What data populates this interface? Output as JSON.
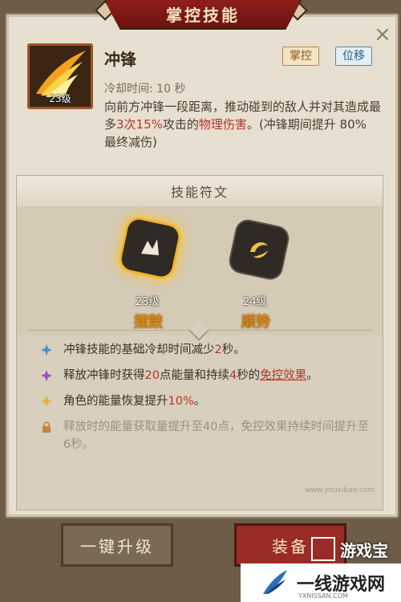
{
  "window": {
    "title": "掌控技能"
  },
  "skill": {
    "name": "冲锋",
    "level": "23级",
    "tags": [
      "掌控",
      "位移"
    ],
    "cooldown": "冷却时间: 10 秒",
    "desc_parts": [
      "向前方冲锋一段距离，推动碰到的敌人并对其造成最多",
      "3次15%",
      "攻击的",
      "物理伤害",
      "。(冲锋期间提升 80% 最终减伤)"
    ]
  },
  "runes": {
    "header": "技能符文",
    "items": [
      {
        "level": "23级",
        "name": "擂鼓"
      },
      {
        "level": "24级",
        "name": "顺势"
      }
    ]
  },
  "effects": [
    {
      "icon": "blue-diamond-icon",
      "parts": [
        "冲锋技能的基础冷却时间减少",
        "2",
        "秒。"
      ]
    },
    {
      "icon": "purple-diamond-icon",
      "parts": [
        "释放冲锋时获得",
        "20",
        "点能量和持续",
        "4",
        "秒的",
        "免控效果",
        "。"
      ]
    },
    {
      "icon": "gold-diamond-icon",
      "parts": [
        "角色的能量恢复提升",
        "10%",
        "。"
      ]
    },
    {
      "icon": "lock-icon",
      "parts": [
        "释放时的能量获取量提升至40点，免控效果持续时间提升至6秒。"
      ]
    }
  ],
  "buttons": {
    "upgrade": "一键升级",
    "equip": "装备"
  },
  "watermark": {
    "site1": "游戏宝",
    "site1_url": "www.youxibao.com",
    "site2": "一线游戏网",
    "site2_url": "YXNISSAN.COM"
  },
  "colors": {
    "accent_red": "#b2342c",
    "rune_name": "#d88a13",
    "title_bar": "#8e1f1b"
  }
}
